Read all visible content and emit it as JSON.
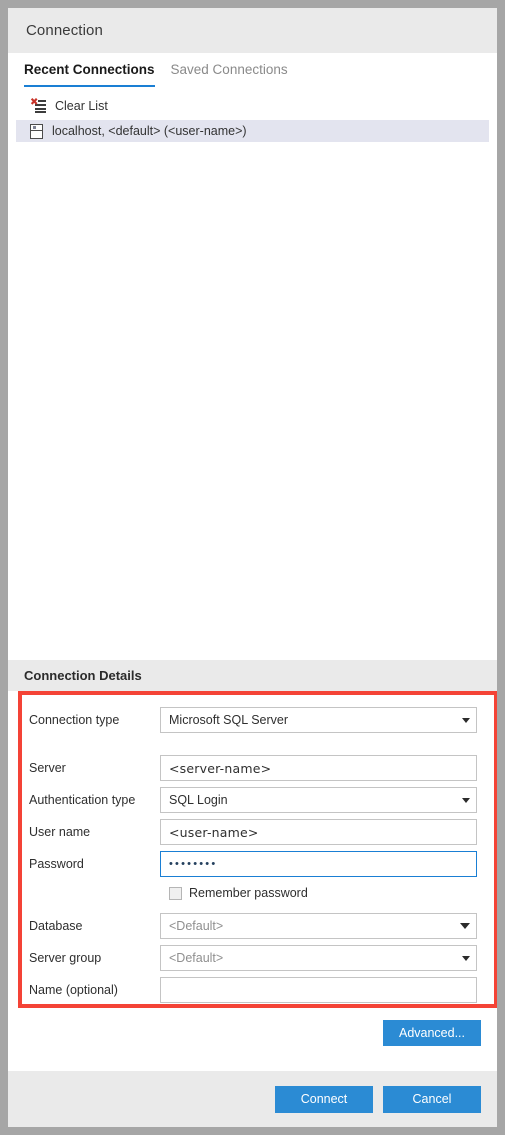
{
  "window": {
    "title": "Connection"
  },
  "tabs": [
    {
      "label": "Recent Connections",
      "active": true
    },
    {
      "label": "Saved Connections",
      "active": false
    }
  ],
  "recent_list": {
    "clear_list_label": "Clear List",
    "clear_list_icon": "clear-list-icon",
    "items": [
      {
        "icon": "server-icon",
        "label": "localhost, <default> (<user-name>)",
        "selected": true
      }
    ]
  },
  "details": {
    "header": "Connection Details",
    "highlight_color": "#f44336",
    "fields": {
      "connection_type": {
        "label": "Connection type",
        "value": "Microsoft SQL Server",
        "control": "dropdown"
      },
      "server": {
        "label": "Server",
        "value": "<server-name>",
        "control": "text"
      },
      "authentication_type": {
        "label": "Authentication type",
        "value": "SQL Login",
        "control": "dropdown"
      },
      "user_name": {
        "label": "User name",
        "value": "<user-name>",
        "control": "text"
      },
      "password": {
        "label": "Password",
        "value": "••••••••",
        "control": "password",
        "focused": true
      },
      "remember_password": {
        "label": "Remember password",
        "checked": false
      },
      "database": {
        "label": "Database",
        "value": "<Default>",
        "control": "combobox",
        "is_placeholder": true
      },
      "server_group": {
        "label": "Server group",
        "value": "<Default>",
        "control": "dropdown",
        "is_placeholder": true
      },
      "name_optional": {
        "label": "Name (optional)",
        "value": "",
        "control": "text"
      }
    }
  },
  "buttons": {
    "advanced": "Advanced...",
    "connect": "Connect",
    "cancel": "Cancel",
    "accent_color": "#2b8bd4"
  }
}
